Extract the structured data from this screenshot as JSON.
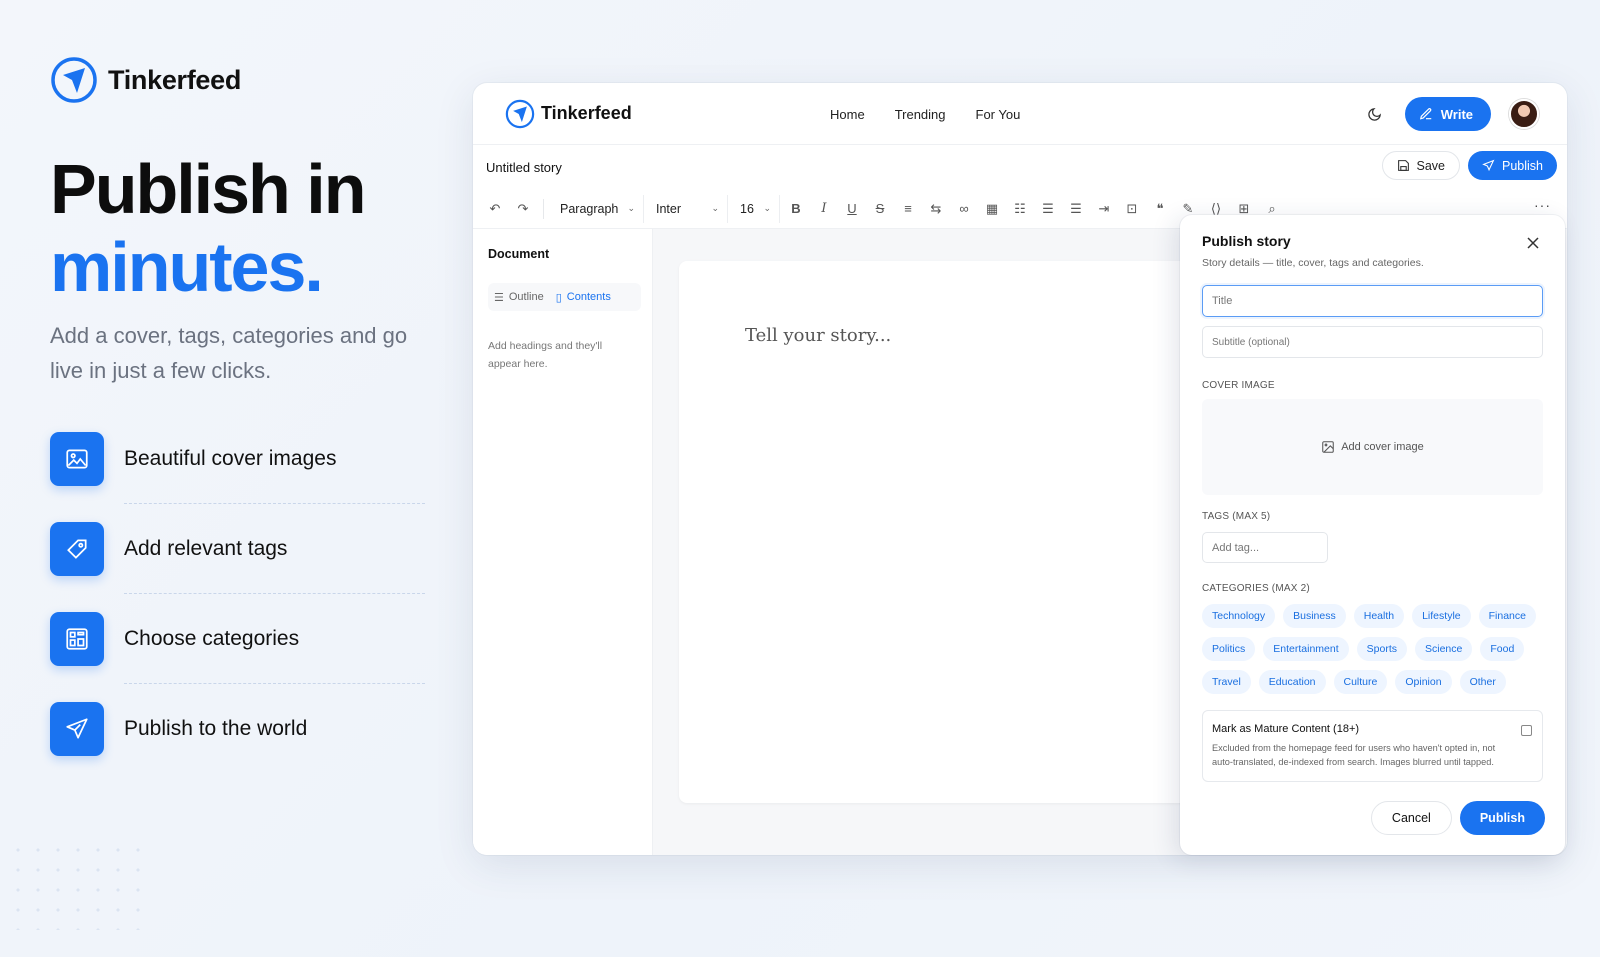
{
  "brand": {
    "name": "Tinkerfeed"
  },
  "hero": {
    "line1": "Publish in",
    "line2": "minutes.",
    "subtitle": "Add a cover, tags, categories and go live in just a few clicks."
  },
  "features": [
    {
      "label": "Beautiful cover images",
      "icon": "image-icon"
    },
    {
      "label": "Add relevant tags",
      "icon": "tag-icon"
    },
    {
      "label": "Choose categories",
      "icon": "categories-icon"
    },
    {
      "label": "Publish to the world",
      "icon": "send-icon"
    }
  ],
  "app": {
    "brand_name": "Tinkerfeed",
    "nav": {
      "home": "Home",
      "trending": "Trending",
      "for_you": "For You"
    },
    "write_label": "Write",
    "story_title": "Untitled story",
    "save_label": "Save",
    "publish_label": "Publish",
    "toolbar": {
      "block_type": "Paragraph",
      "font": "Inter",
      "size": "16"
    },
    "sidebar": {
      "title": "Document",
      "tab_outline": "Outline",
      "tab_contents": "Contents",
      "hint": "Add headings and they'll appear here."
    },
    "editor_placeholder": "Tell your story..."
  },
  "panel": {
    "title": "Publish story",
    "subtitle": "Story details — title, cover, tags and categories.",
    "title_placeholder": "Title",
    "subtitle_placeholder": "Subtitle (optional)",
    "cover_label": "COVER IMAGE",
    "cover_cta": "Add cover image",
    "tags_label": "TAGS (MAX 5)",
    "tag_placeholder": "Add tag...",
    "categories_label": "CATEGORIES (MAX 2)",
    "categories": [
      "Technology",
      "Business",
      "Health",
      "Lifestyle",
      "Finance",
      "Politics",
      "Entertainment",
      "Sports",
      "Science",
      "Food",
      "Travel",
      "Education",
      "Culture",
      "Opinion",
      "Other"
    ],
    "mature_title": "Mark as Mature Content (18+)",
    "mature_desc": "Excluded from the homepage feed for users who haven't opted in, not auto-translated, de-indexed from search. Images blurred until tapped.",
    "cancel_label": "Cancel",
    "publish_label": "Publish"
  },
  "colors": {
    "accent": "#1a73f0",
    "chip_bg": "#eef5ff",
    "muted": "#6b7280"
  }
}
